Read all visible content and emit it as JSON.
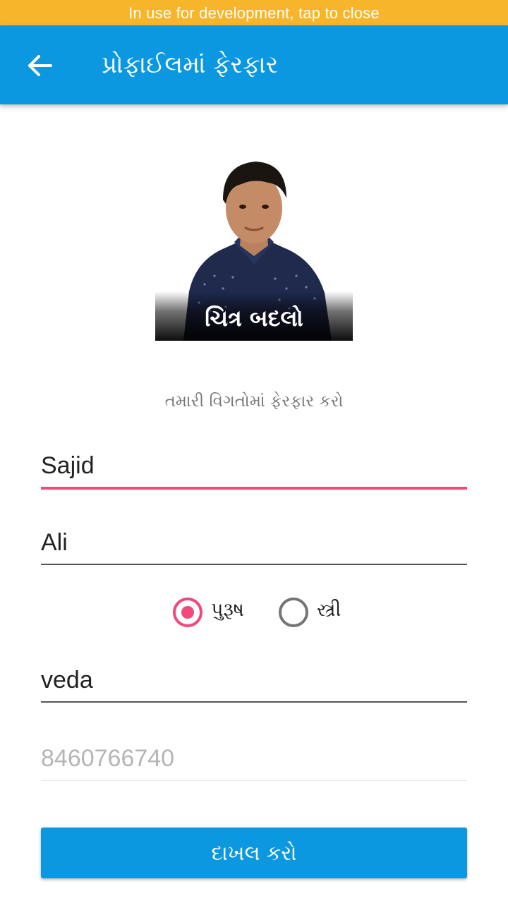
{
  "dev_banner": {
    "text": "In use for development, tap to close"
  },
  "appbar": {
    "title": "પ્રોફાઈલમાં ફેરફાર",
    "back_icon": "arrow-left-icon",
    "color": "#0b98e0"
  },
  "profile": {
    "change_photo_label": "ચિત્ર બદલો"
  },
  "form": {
    "subtitle": "તમારી વિગતોમાં ફેરફાર કરો",
    "first_name": {
      "value": "Sajid"
    },
    "last_name": {
      "value": "Ali"
    },
    "gender": {
      "options": [
        {
          "label": "પુરૂષ",
          "selected": true
        },
        {
          "label": "સ્ત્રી",
          "selected": false
        }
      ]
    },
    "city": {
      "value": "veda"
    },
    "phone": {
      "placeholder": "8460766740"
    },
    "submit_label": "દાખલ કરો"
  },
  "colors": {
    "accent": "#f0497a",
    "primary": "#0b98e0",
    "banner": "#f7b52c"
  }
}
